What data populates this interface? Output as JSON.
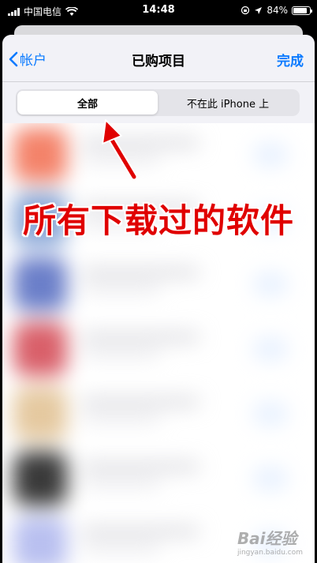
{
  "status_bar": {
    "carrier": "中国电信",
    "time": "14:48",
    "battery": "84%",
    "battery_level": 0.84,
    "icons": [
      "signal-icon",
      "wifi-icon",
      "orientation-lock-icon",
      "location-icon",
      "battery-icon"
    ]
  },
  "nav": {
    "back_label": "帐户",
    "title": "已购项目",
    "done_label": "完成"
  },
  "segment": {
    "options": [
      "全部",
      "不在此 iPhone 上"
    ],
    "selected_index": 0
  },
  "annotation": {
    "caption": "所有下载过的软件"
  },
  "watermark": {
    "text": "Bai经验",
    "sub": "jingyan.baidu.com"
  },
  "colors": {
    "accent": "#0a7aff",
    "caption": "#e00000",
    "sheet_bg": "#f2f2f7"
  },
  "app_icon_colors": [
    "#f4836a",
    "#8aa8d8",
    "#6b7fc9",
    "#d9606a",
    "#e5c9a0",
    "#3a3a3a",
    "#b9c0f0"
  ]
}
